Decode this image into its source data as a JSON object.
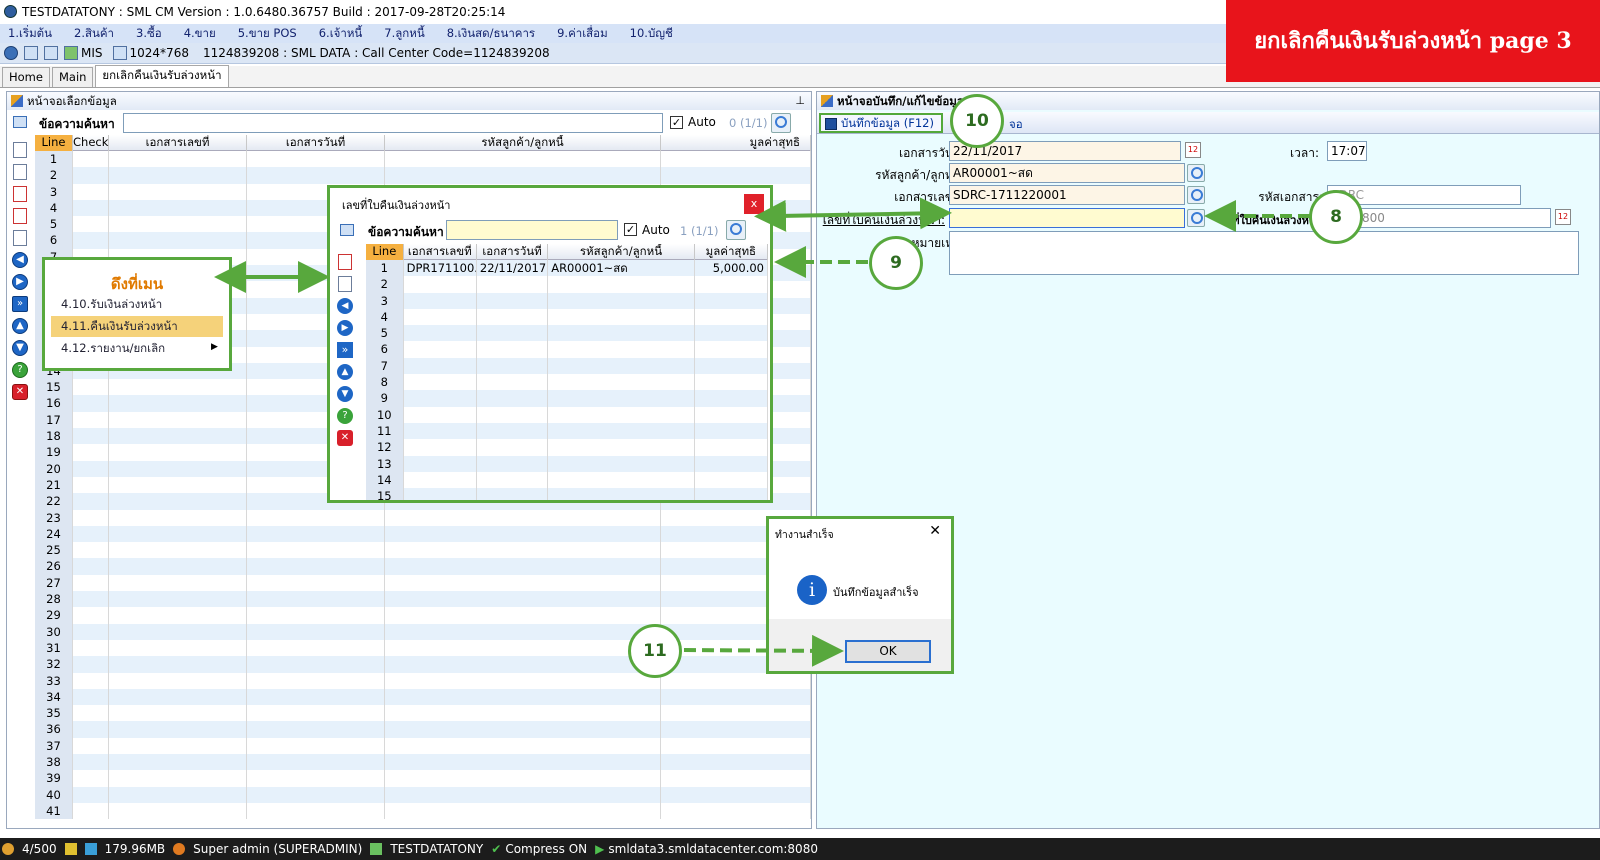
{
  "window": {
    "title": "TESTDATATONY : SML CM Version : 1.0.6480.36757  Build : 2017-09-28T20:25:14"
  },
  "menu": [
    "1.เริ่มต้น",
    "2.สินค้า",
    "3.ซื้อ",
    "4.ขาย",
    "5.ขาย POS",
    "6.เจ้าหนี้",
    "7.ลูกหนี้",
    "8.เงินสด/ธนาคาร",
    "9.ค่าเสื่อม",
    "10.บัญชี"
  ],
  "toolbar": {
    "mis": "MIS",
    "resolution": "1024*768",
    "info": "1124839208 : SML DATA : Call Center Code=1124839208"
  },
  "tabs": [
    "Home",
    "Main",
    "ยกเลิกคืนเงินรับล่วงหน้า"
  ],
  "banner": "ยกเลิกคืนเงินรับล่วงหน้า  page 3",
  "left": {
    "title": "หน้าจอเลือกข้อมูล",
    "search_label": "ข้อความค้นหา",
    "auto_label": "Auto",
    "count": "0 (1/1)",
    "columns": [
      "Line",
      "Check",
      "เอกสารเลขที่",
      "เอกสารวันที่",
      "รหัสลูกค้า/ลูกหนี้",
      "มูลค่าสุทธิ"
    ],
    "rows": [
      "1",
      "2",
      "3",
      "4",
      "5",
      "6",
      "7",
      "8",
      "9",
      "10",
      "11",
      "12",
      "13",
      "14",
      "15",
      "16",
      "17",
      "18",
      "19",
      "20",
      "21",
      "22",
      "23",
      "24",
      "25",
      "26",
      "27",
      "28",
      "29",
      "30",
      "31",
      "32",
      "33",
      "34",
      "35",
      "36",
      "37",
      "38",
      "39",
      "40",
      "41"
    ]
  },
  "right": {
    "title": "หน้าจอบันทึก/แก้ไขข้อมูล",
    "save_button": "บันทึกข้อมูล (F12)",
    "close_button": "จอ",
    "labels": {
      "doc_date": "เอกสารวันที่:",
      "customer": "รหัสลูกค้า/ลูกหนี้:",
      "doc_no": "เอกสารเลขที่:",
      "advance_no": "เลขที่ใบคืนเงินล่วงหน้า:",
      "remark": "หมายเหตุ:",
      "time": "เวลา:",
      "doc_code": "รหัสเอกสาร:",
      "advance_date": "วันที่ใบคืนเงินล่วงหน้า:"
    },
    "values": {
      "doc_date": "22/11/2017",
      "customer": "AR00001~สด",
      "doc_no": "SDRC-1711220001",
      "time": "17:07",
      "doc_code": "SDRC",
      "advance_date": "1/1/1800",
      "advance_no": ""
    }
  },
  "popup": {
    "title": "เลขที่ใบคืนเงินล่วงหน้า",
    "close": "x",
    "search_label": "ข้อความค้นหา",
    "auto_label": "Auto",
    "count": "1 (1/1)",
    "columns": [
      "Line",
      "เอกสารเลขที่",
      "เอกสารวันที่",
      "รหัสลูกค้า/ลูกหนี้",
      "มูลค่าสุทธิ"
    ],
    "first_row": {
      "line": "1",
      "doc_no": "DPR171100..",
      "doc_date": "22/11/2017",
      "customer": "AR00001~สด",
      "amount": "5,000.00"
    },
    "rows": [
      "2",
      "3",
      "4",
      "5",
      "6",
      "7",
      "8",
      "9",
      "10",
      "11",
      "12",
      "13",
      "14",
      "15"
    ]
  },
  "msgbox": {
    "title": "ทำงานสำเร็จ",
    "message": "บันทึกข้อมูลสำเร็จ",
    "ok": "OK",
    "close": "✕"
  },
  "side_menu": {
    "title": "ดึงที่เมน",
    "items": [
      "4.10.รับเงินล่วงหน้า",
      "4.11.คืนเงินรับล่วงหน้า",
      "4.12.รายงาน/ยกเลิก"
    ]
  },
  "callouts": [
    "8",
    "9",
    "10",
    "11"
  ],
  "statusbar": {
    "users": "4/500",
    "memory": "179.96MB",
    "user": "Super admin (SUPERADMIN)",
    "db": "TESTDATATONY",
    "compress": "Compress ON",
    "server": "smldata3.smldatacenter.com:8080"
  },
  "colors": {
    "accent_green": "#58a83d",
    "banner_red": "#e8141b"
  }
}
